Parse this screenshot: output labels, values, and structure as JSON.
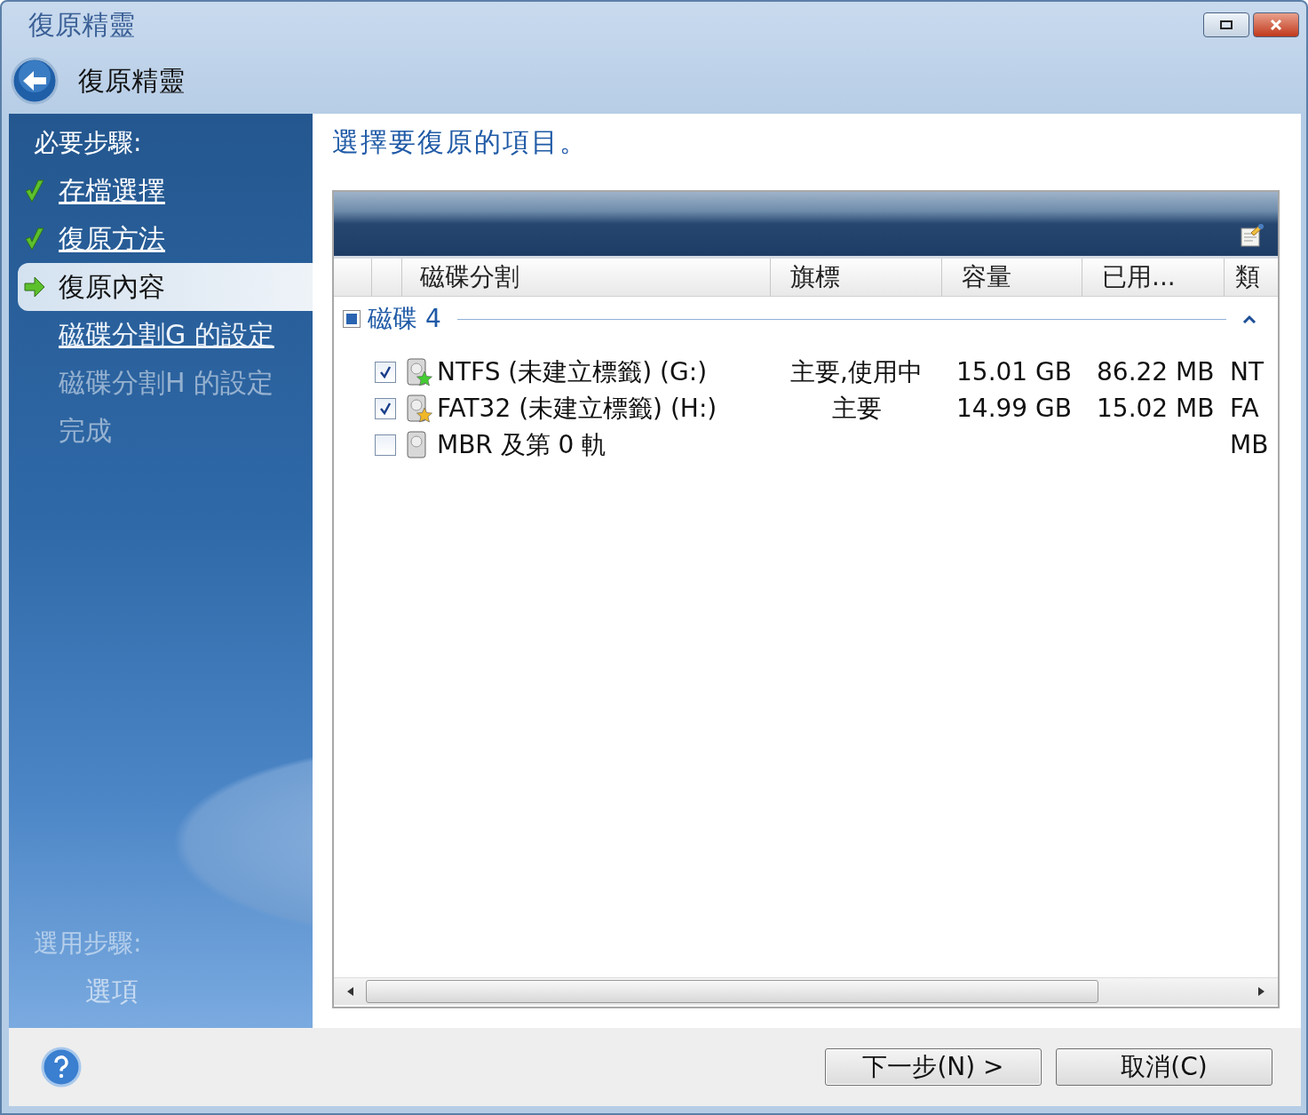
{
  "window": {
    "title": "復原精靈"
  },
  "header": {
    "title": "復原精靈"
  },
  "sidebar": {
    "required_heading": "必要步驟:",
    "steps": [
      {
        "label": "存檔選擇",
        "completed": true,
        "selected": false,
        "disabled": false
      },
      {
        "label": "復原方法",
        "completed": true,
        "selected": false,
        "disabled": false
      },
      {
        "label": "復原內容",
        "completed": false,
        "selected": true,
        "disabled": false
      },
      {
        "label": "磁碟分割G 的設定",
        "completed": false,
        "selected": false,
        "disabled": false
      },
      {
        "label": "磁碟分割H 的設定",
        "completed": false,
        "selected": false,
        "disabled": true
      },
      {
        "label": "完成",
        "completed": false,
        "selected": false,
        "disabled": true
      }
    ],
    "optional_heading": "選用步驟:",
    "optional_steps": [
      {
        "label": "選項",
        "completed": false,
        "selected": false,
        "disabled": true
      }
    ]
  },
  "instruction": "選擇要復原的項目。",
  "table": {
    "columns": [
      "",
      "",
      "磁碟分割",
      "旗標",
      "容量",
      "已用...",
      "類"
    ],
    "groups": [
      {
        "label": "磁碟 4",
        "partial": true,
        "expanded": true,
        "rows": [
          {
            "checked": true,
            "color": "#44cc33",
            "name": "NTFS (未建立標籤) (G:)",
            "flags": "主要,使用中",
            "capacity": "15.01 GB",
            "used": "86.22 MB",
            "type": "NT"
          },
          {
            "checked": true,
            "color": "#f0b828",
            "name": "FAT32 (未建立標籤) (H:)",
            "flags": "主要",
            "capacity": "14.99 GB",
            "used": "15.02 MB",
            "type": "FA"
          },
          {
            "checked": false,
            "name": "MBR 及第 0 軌",
            "type": "MB"
          }
        ]
      }
    ]
  },
  "buttons": [
    {
      "label": "下一步(N) >",
      "kind": "primary"
    },
    {
      "label": "取消(C)",
      "kind": "cancel"
    }
  ]
}
